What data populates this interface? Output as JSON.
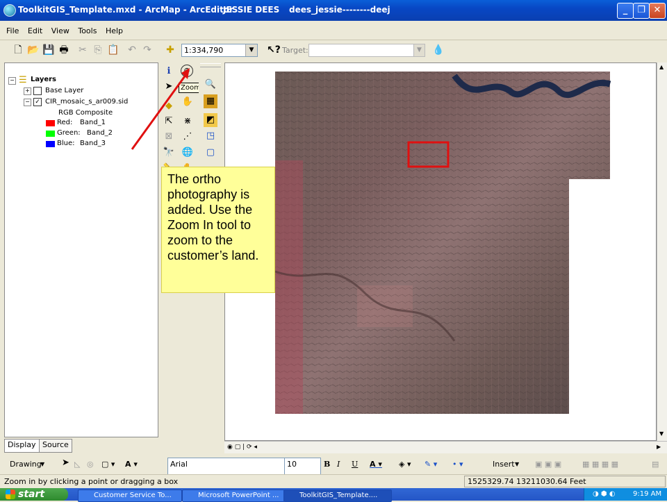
{
  "window": {
    "title": "ToolkitGIS_Template.mxd - ArcMap - ArcEditor",
    "user": "JESSIE DEES",
    "account": "dees_jessie--------deej"
  },
  "menu": [
    "File",
    "Edit",
    "View",
    "Tools",
    "Help"
  ],
  "toolbar": {
    "scale": "1:334,790",
    "target_label": "Target:",
    "target_value": ""
  },
  "toc": {
    "root": "Layers",
    "layers": [
      {
        "name": "Base Layer",
        "checked": false,
        "expanded": false
      },
      {
        "name": "CIR_mosaic_s_ar009.sid",
        "checked": true,
        "expanded": true
      }
    ],
    "composite_label": "RGB Composite",
    "bands": [
      {
        "label": "Red:",
        "value": "Band_1",
        "color": "#ff0000"
      },
      {
        "label": "Green:",
        "value": "Band_2",
        "color": "#00ff00"
      },
      {
        "label": "Blue:",
        "value": "Band_3",
        "color": "#0000ff"
      }
    ],
    "tabs": [
      "Display",
      "Source"
    ]
  },
  "tooltip": "Zoom In",
  "callout": "The ortho photography is added. Use the Zoom In tool to zoom to the customer’s land.",
  "drawbar": {
    "drawing_label": "Drawing",
    "font": "Arial",
    "size": "10",
    "insert_label": "Insert"
  },
  "status": {
    "message": "Zoom in by clicking a point or dragging a box",
    "coords": "1525329.74  13211030.64 Feet"
  },
  "taskbar": {
    "start": "start",
    "tasks": [
      "Customer Service To...",
      "Microsoft PowerPoint ...",
      "ToolkitGIS_Template...."
    ],
    "clock": "9:19 AM"
  },
  "colors": {
    "titlebar": "#0a4fc9",
    "callout_bg": "#ffff99",
    "highlight_box": "#e01010",
    "arrow": "#e01010"
  }
}
